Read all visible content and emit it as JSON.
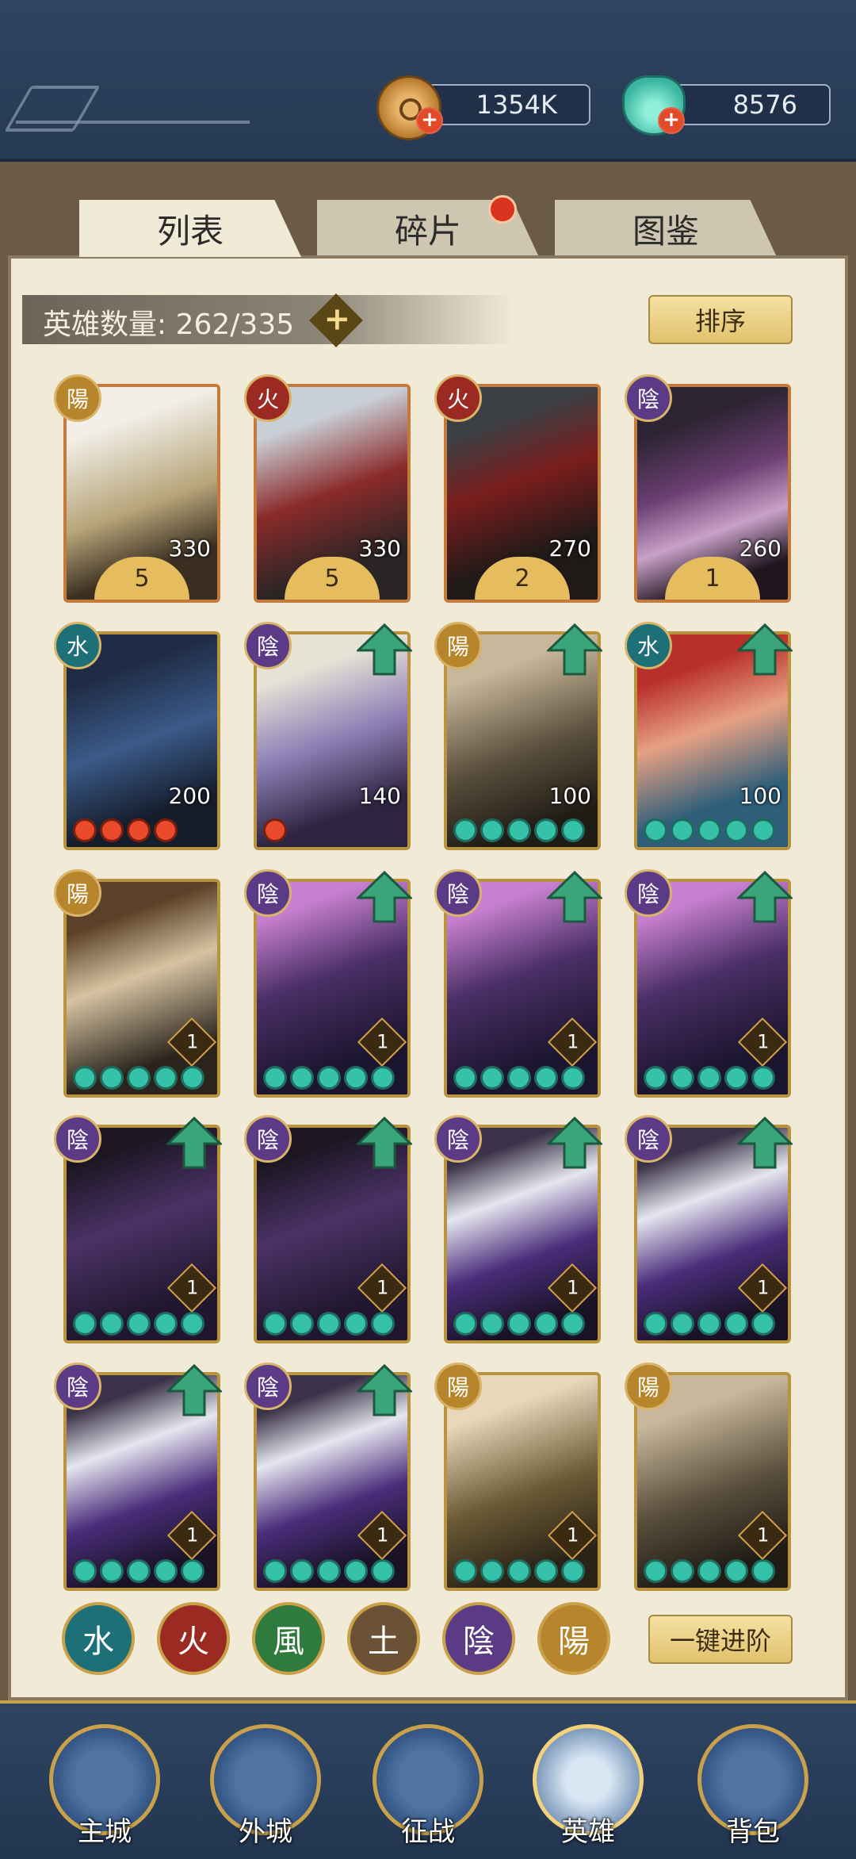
{
  "resources": {
    "coins": "1354K",
    "gems": "8576",
    "add_coin": "+",
    "add_gem": "+"
  },
  "tabs": [
    {
      "label": "列表",
      "active": true
    },
    {
      "label": "碎片",
      "badge": true
    },
    {
      "label": "图鉴"
    }
  ],
  "hero_count": {
    "label": "英雄数量: 262/335",
    "add": "+"
  },
  "sort_button": "排序",
  "advance_button": "一键进阶",
  "heroes": [
    {
      "element": "陽",
      "level": "330",
      "stars": "5"
    },
    {
      "element": "火",
      "level": "330",
      "stars": "5"
    },
    {
      "element": "火",
      "level": "270",
      "stars": "2"
    },
    {
      "element": "陰",
      "level": "260",
      "stars": "1"
    },
    {
      "element": "水",
      "level": "200"
    },
    {
      "element": "陰",
      "level": "140"
    },
    {
      "element": "陽",
      "level": "100"
    },
    {
      "element": "水",
      "level": "100"
    },
    {
      "element": "陽",
      "level": "1"
    },
    {
      "element": "陰",
      "level": "1"
    },
    {
      "element": "陰",
      "level": "1"
    },
    {
      "element": "陰",
      "level": "1"
    },
    {
      "element": "陰",
      "level": "1"
    },
    {
      "element": "陰",
      "level": "1"
    },
    {
      "element": "陰",
      "level": "1"
    },
    {
      "element": "陰",
      "level": "1"
    },
    {
      "element": "陰",
      "level": "1"
    },
    {
      "element": "陰",
      "level": "1"
    },
    {
      "element": "陽",
      "level": "1"
    },
    {
      "element": "陽",
      "level": "1"
    }
  ],
  "element_filters": [
    {
      "label": "水",
      "color": "#1d6f78"
    },
    {
      "label": "火",
      "color": "#9b2b22"
    },
    {
      "label": "風",
      "color": "#2f7a3d"
    },
    {
      "label": "土",
      "color": "#6b5236"
    },
    {
      "label": "陰",
      "color": "#5b3b86"
    },
    {
      "label": "陽",
      "color": "#b7852b"
    }
  ],
  "nav": [
    {
      "label": "主城"
    },
    {
      "label": "外城"
    },
    {
      "label": "征战"
    },
    {
      "label": "英雄",
      "active": true
    },
    {
      "label": "背包"
    }
  ],
  "colors": {
    "yang": "#b7852b",
    "yin": "#5b3b86",
    "fire": "#9b2b22",
    "water": "#1d6f78",
    "upgrade_arrow": "#3aa57a"
  }
}
